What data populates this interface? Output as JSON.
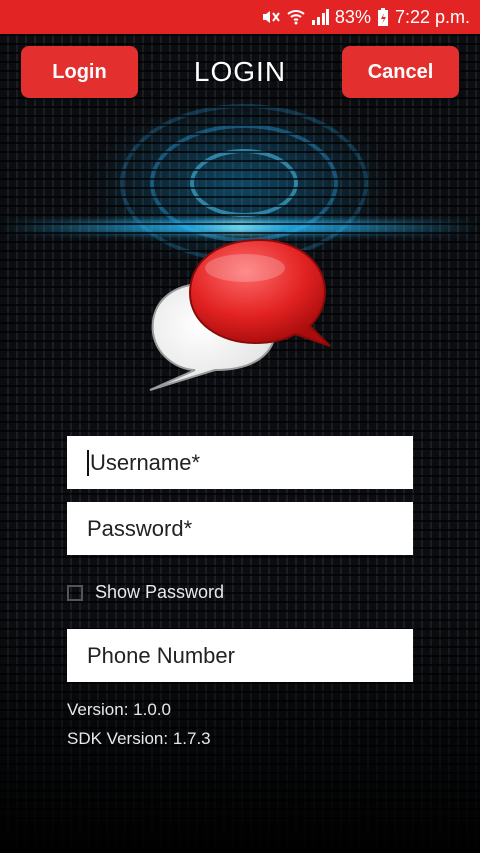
{
  "status_bar": {
    "battery": "83%",
    "time": "7:22 p.m.",
    "icons": [
      "mute-icon",
      "wifi-icon",
      "signal-icon",
      "battery-charging-icon"
    ]
  },
  "header": {
    "login_label": "Login",
    "title": "LOGIN",
    "cancel_label": "Cancel"
  },
  "form": {
    "username_placeholder": "Username*",
    "password_placeholder": "Password*",
    "show_password_label": "Show Password",
    "phone_placeholder": "Phone Number"
  },
  "info": {
    "version": "Version: 1.0.0",
    "sdk_version": "SDK Version: 1.7.3"
  },
  "colors": {
    "accent": "#e3302f",
    "status_bar": "#e32424"
  }
}
